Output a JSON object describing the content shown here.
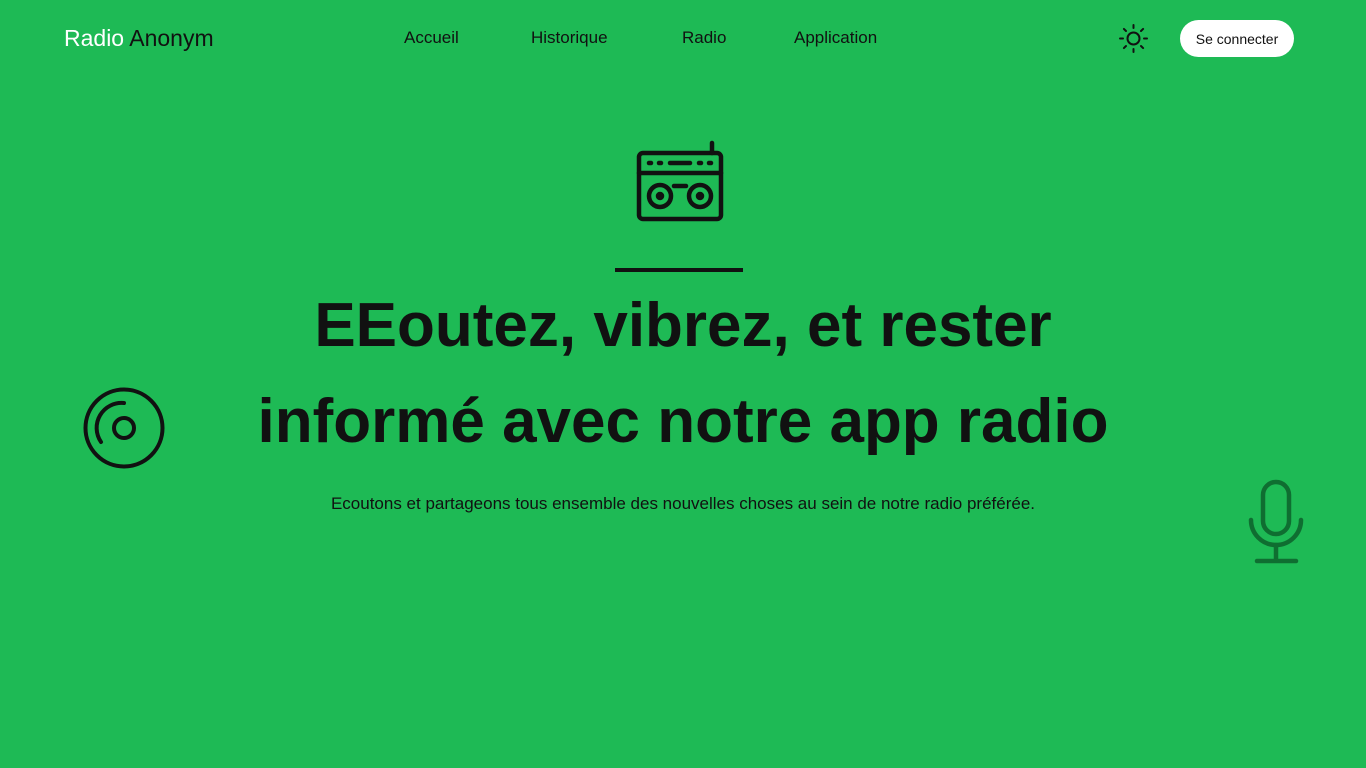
{
  "header": {
    "logo_first": "Radio",
    "logo_second": "Anonym",
    "nav": [
      {
        "label": "Accueil"
      },
      {
        "label": "Historique"
      },
      {
        "label": "Radio"
      },
      {
        "label": "Application"
      }
    ],
    "theme_toggle_icon": "sun-icon",
    "login_label": "Se connecter"
  },
  "hero": {
    "icon": "radio-icon",
    "title_line1": "EEoutez, vibrez, et rester",
    "title_line2": "informé avec notre app radio",
    "subtitle": "Ecoutons et partageons tous ensemble des nouvelles choses au sein de notre radio préférée."
  },
  "decorations": {
    "left_icon": "disc-icon",
    "right_icon": "microphone-icon"
  },
  "colors": {
    "background": "#1eba55",
    "text": "#111111",
    "logo_accent": "#ffffff",
    "button_bg": "#ffffff",
    "mic_color": "#0f6e31"
  }
}
